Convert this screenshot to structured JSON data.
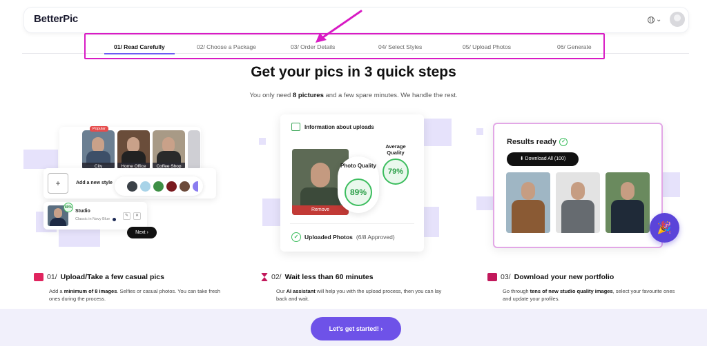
{
  "app": {
    "logo": "BetterPic"
  },
  "header": {
    "lang_caret": "⌄"
  },
  "steps": [
    {
      "label": "01/ Read Carefully",
      "active": true
    },
    {
      "label": "02/ Choose a Package",
      "active": false
    },
    {
      "label": "03/ Order Details",
      "active": false
    },
    {
      "label": "04/ Select Styles",
      "active": false
    },
    {
      "label": "05/ Upload Photos",
      "active": false
    },
    {
      "label": "06/ Generate",
      "active": false
    }
  ],
  "hero": {
    "title": "Get your pics in 3 quick steps",
    "subtitle_pre": "You only need ",
    "subtitle_bold": "8 pictures",
    "subtitle_post": " and a few spare minutes. We handle the rest."
  },
  "card1": {
    "popular": "Popular",
    "styles": [
      "City",
      "Home Office",
      "Coffee Shop"
    ],
    "add_style": "Add a new style",
    "plus": "+",
    "swatches": [
      "#3b4147",
      "#a8d3e8",
      "#3e8f45",
      "#7a1a1f",
      "#6b4a3a"
    ],
    "studio_badge": "80%",
    "studio_name": "Studio",
    "studio_sub": "Classic in Navy Blue",
    "edit_icon": "✎",
    "delete_icon": "✕",
    "next": "Next ›"
  },
  "card2": {
    "heading": "Information about uploads",
    "remove": "Remove",
    "photo_quality_label": "Photo Quality",
    "photo_quality": "89%",
    "avg_quality_label": "Average Quality",
    "avg_quality": "79%",
    "uploaded_label": "Uploaded Photos",
    "uploaded_count": "(6/8 Approved)",
    "check": "✓"
  },
  "card3": {
    "heading": "Results ready",
    "check": "✓",
    "download": "⬇ Download All (100)",
    "party": "🎉"
  },
  "features": [
    {
      "num": "01/",
      "title": "Upload/Take a few casual pics",
      "desc_pre": "Add a ",
      "desc_bold": "minimum of 8 images",
      "desc_post": ". Selfies or casual photos. You can take fresh ones during the process.",
      "icon_color": "#e0245e"
    },
    {
      "num": "02/",
      "title": "Wait less than 60 minutes",
      "desc_pre": "Our ",
      "desc_bold": "AI assistant",
      "desc_post": " will help you with the upload process, then you can lay back and wait.",
      "icon_color": "#c2185b"
    },
    {
      "num": "03/",
      "title": "Download your new portfolio",
      "desc_pre": "Go through ",
      "desc_bold": "tens of new studio quality images",
      "desc_post": ", select your favourite ones and update your profiles.",
      "icon_color": "#c2185b"
    }
  ],
  "cta": {
    "label": "Let's get started!  ›"
  },
  "colors": {
    "accent": "#6e52e8",
    "highlight_box": "#d81bc4",
    "quality_green": "#3cbd5e"
  }
}
